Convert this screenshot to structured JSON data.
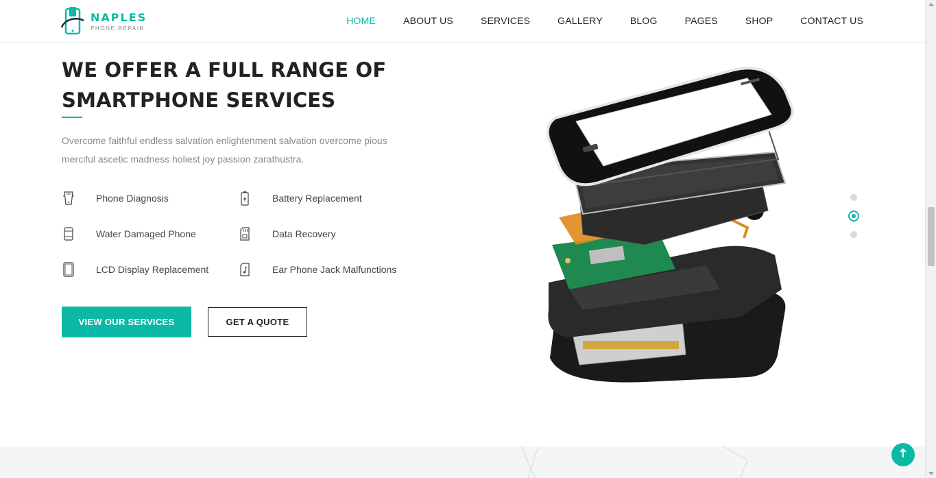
{
  "brand": {
    "name": "NAPLES",
    "tagline": "PHONE REPAIR",
    "accent_color": "#0cb9a6"
  },
  "nav": {
    "items": [
      {
        "label": "HOME",
        "active": true
      },
      {
        "label": "ABOUT US",
        "active": false
      },
      {
        "label": "SERVICES",
        "active": false
      },
      {
        "label": "GALLERY",
        "active": false
      },
      {
        "label": "BLOG",
        "active": false
      },
      {
        "label": "PAGES",
        "active": false
      },
      {
        "label": "SHOP",
        "active": false
      },
      {
        "label": "CONTACT US",
        "active": false
      }
    ]
  },
  "hero": {
    "title_line1": "WE OFFER A FULL RANGE OF",
    "title_line2": "SMARTPHONE SERVICES",
    "description_line1": "Overcome faithful endless salvation enlightenment salvation overcome pious",
    "description_line2": "merciful ascetic madness holiest joy passion zarathustra.",
    "features": [
      {
        "label": "Phone Diagnosis",
        "icon": "phone-diagnosis-icon"
      },
      {
        "label": "Battery Replacement",
        "icon": "battery-icon"
      },
      {
        "label": "Water Damaged Phone",
        "icon": "water-damage-icon"
      },
      {
        "label": "Data Recovery",
        "icon": "sd-card-icon"
      },
      {
        "label": "LCD Display Replacement",
        "icon": "lcd-display-icon"
      },
      {
        "label": "Ear Phone Jack Malfunctions",
        "icon": "music-note-icon"
      }
    ],
    "primary_button": "VIEW OUR SERVICES",
    "secondary_button": "GET A QUOTE"
  },
  "slider": {
    "total": 3,
    "active_index": 1
  },
  "back_to_top_icon": "arrow-up-icon"
}
